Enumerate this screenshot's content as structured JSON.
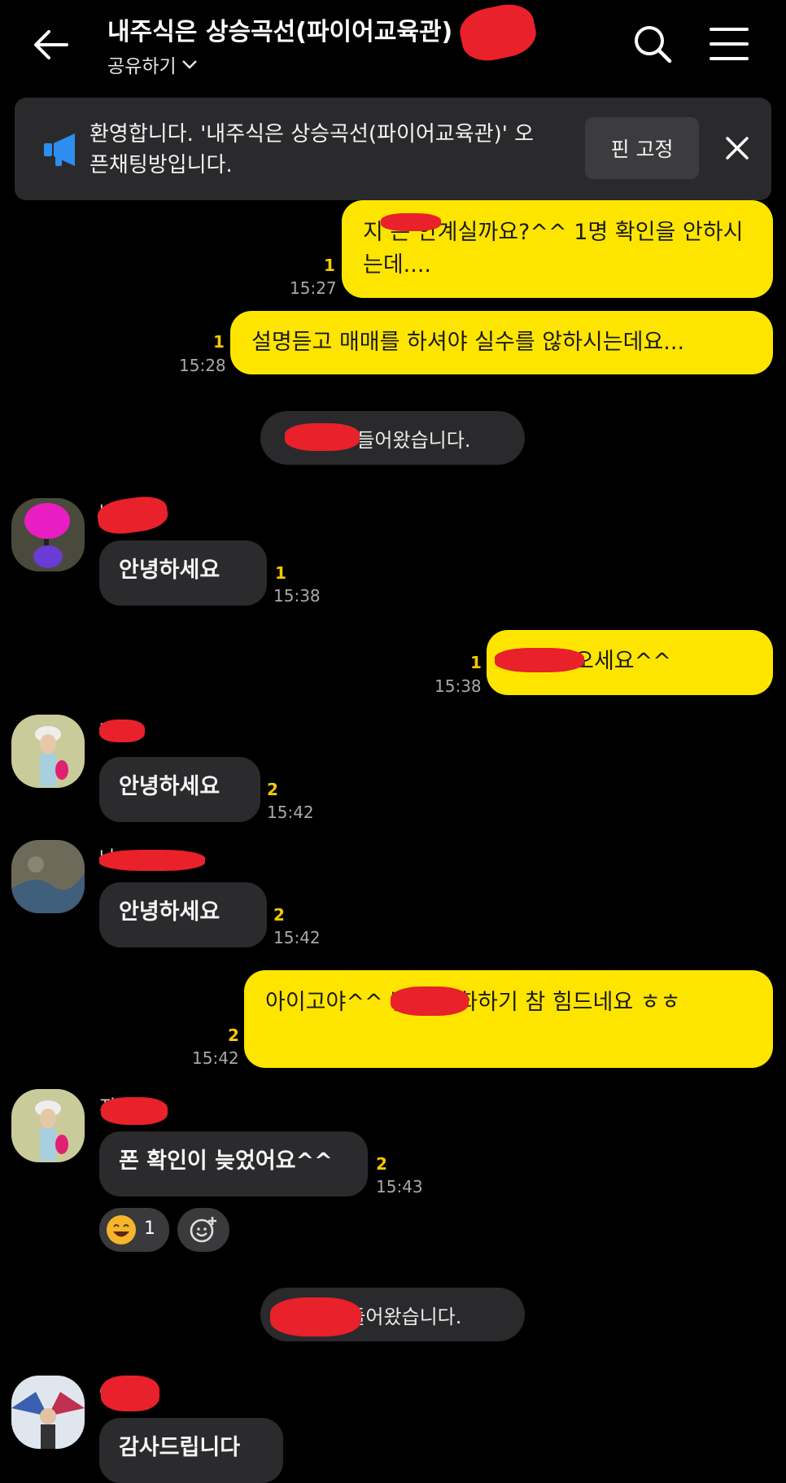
{
  "header": {
    "title": "내주식은 상승곡선(파이어교육관)",
    "share_label": "공유하기"
  },
  "notice": {
    "text": "환영합니다. '내주식은 상승곡선(파이어교육관)' 오픈채팅방입니다.",
    "pin_label": "핀 고정"
  },
  "messages": [
    {
      "text": "지     은 안계실까요?^^ 1명 확인을 안하시는데....",
      "count": "1",
      "time": "15:27"
    },
    {
      "text": "설명듣고 매매를 하셔야 실수를 않하시는데요...",
      "count": "1",
      "time": "15:28"
    },
    {
      "text": "    님이 들어왔습니다."
    },
    {
      "name": "박  ",
      "text": "안녕하세요",
      "count": "1",
      "time": "15:38"
    },
    {
      "text": "     님 어서오세요^^",
      "count": "1",
      "time": "15:38"
    },
    {
      "name": "지  ",
      "text": "안녕하세요",
      "count": "2",
      "time": "15:42"
    },
    {
      "name": "나     ",
      "text": "안녕하세요",
      "count": "2",
      "time": "15:42"
    },
    {
      "text": "아이고야^^     님과 대화하기 참 힘드네요 ㅎㅎ",
      "count": "2",
      "time": "15:42"
    },
    {
      "name": "지  ",
      "text": "폰 확인이 늦었어요^^",
      "count": "2",
      "time": "15:43",
      "reaction_count": "1"
    },
    {
      "text": "     이 들어왔습니다."
    },
    {
      "name": "아  ",
      "text": "감사드립니다"
    }
  ],
  "colors": {
    "background": "#000000",
    "my_bubble": "#fee500",
    "their_bubble": "#2b2b2d",
    "unread_count": "#f6c800",
    "redaction": "#e8212a"
  },
  "icons": [
    "back-arrow-icon",
    "search-icon",
    "menu-icon",
    "megaphone-icon",
    "close-icon",
    "chevron-down-icon",
    "add-reaction-icon",
    "grinning-emoji-icon"
  ]
}
